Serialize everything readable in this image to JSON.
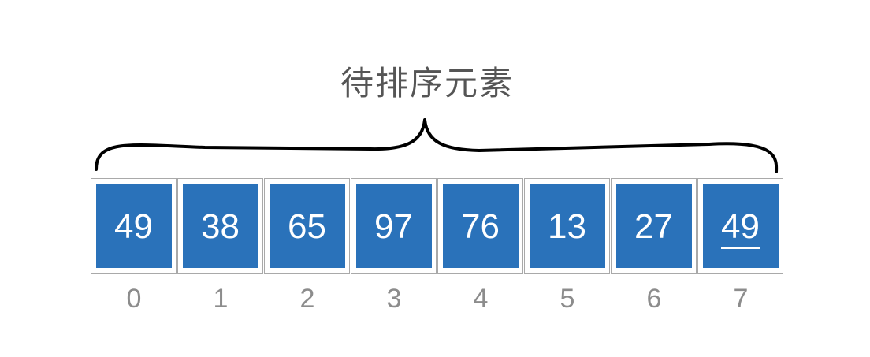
{
  "title": "待排序元素",
  "cells": [
    {
      "value": "49",
      "index": "0",
      "underlined": false
    },
    {
      "value": "38",
      "index": "1",
      "underlined": false
    },
    {
      "value": "65",
      "index": "2",
      "underlined": false
    },
    {
      "value": "97",
      "index": "3",
      "underlined": false
    },
    {
      "value": "76",
      "index": "4",
      "underlined": false
    },
    {
      "value": "13",
      "index": "5",
      "underlined": false
    },
    {
      "value": "27",
      "index": "6",
      "underlined": false
    },
    {
      "value": "49",
      "index": "7",
      "underlined": true
    }
  ],
  "colors": {
    "box_fill": "#2a72ba",
    "box_text": "#ffffff",
    "cell_border": "#a9a9a9",
    "title_text": "#555555",
    "index_text": "#8c8c8c",
    "brace_stroke": "#000000"
  }
}
